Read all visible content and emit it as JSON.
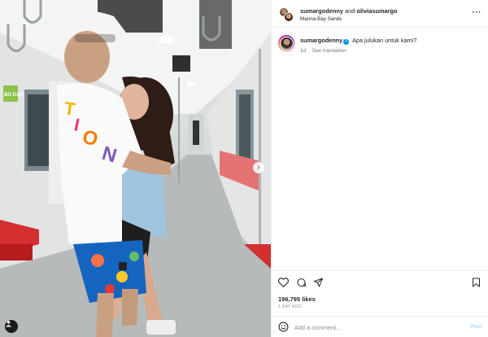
{
  "post": {
    "header": {
      "author": "sumargodenny",
      "joiner": "and",
      "collaborator": "oliviasumargo",
      "location": "Marina Bay Sands",
      "more_icon": "more-horizontal-icon"
    },
    "caption": {
      "username": "sumargodenny",
      "verified": true,
      "text": "Apa julukan untuk kami?",
      "age": "1d",
      "see_translation": "See translation"
    },
    "actions": {
      "icons": [
        "heart-icon",
        "comment-icon",
        "share-icon",
        "bookmark-icon"
      ],
      "likes": "196,795 likes",
      "age_label": "1 DAY AGO"
    },
    "comment": {
      "placeholder": "Add a comment...",
      "post_label": "Post"
    },
    "media": {
      "slide_arrow": "›",
      "signage_text": "BG DAN"
    }
  },
  "colors": {
    "accent": "#0095f6",
    "post_disabled": "#b2dffc",
    "train_red": "#d32f2f"
  }
}
